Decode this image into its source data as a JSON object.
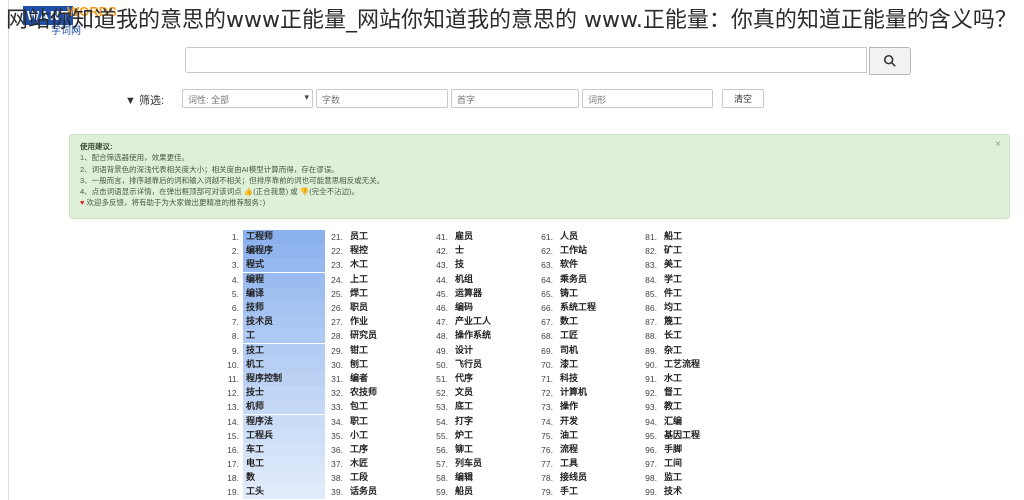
{
  "overlay_title": "网站你知道我的意思的www正能量_网站你知道我的意思的 www.正能量：你真的知道正能量的含义吗？",
  "logo": {
    "want": "WANT",
    "words": "WORDS",
    "sub": "字词网"
  },
  "search": {
    "placeholder": ""
  },
  "filter": {
    "label": "▼ 筛选:",
    "pos_select": "词性: 全部",
    "char_placeholder": "字数",
    "start_placeholder": "首字",
    "end_placeholder": "词形",
    "clear_label": "清空"
  },
  "tips": {
    "title": "使用建议:",
    "lines": [
      "1、配合筛选器使用，效果更佳。",
      "2、词语背景色的深浅代表相关度大小；相关度由AI模型计算而得，存在谬误。",
      "3、一般而言，排序越靠后的词和输入词越不相关；但排序靠前的词也可能意思相反或无关。",
      "4、点击词语显示详情，在弹出框顶部可对该词点 👍(正合我意) 或 👎(完全不沾边)。",
      "欢迎多反馈，将有助于为大家做出更精准的推荐服务：)"
    ]
  },
  "colors": {
    "accent": "#1f4fa8",
    "tips_bg": "#dff0d8",
    "highlight": "#8fb4ec"
  },
  "words": {
    "col1": [
      "工程师",
      "编程序",
      "程式",
      "编程",
      "编译",
      "技师",
      "技术员",
      "工",
      "技工",
      "机工",
      "程序控制",
      "技士",
      "机师",
      "程序法",
      "工程兵",
      "车工",
      "电工",
      "数",
      "工头"
    ],
    "col2": [
      "员工",
      "程控",
      "木工",
      "上工",
      "焊工",
      "职员",
      "作业",
      "研究员",
      "钳工",
      "刨工",
      "编者",
      "农技师",
      "包工",
      "职工",
      "小工",
      "工序",
      "木匠",
      "工段",
      "话务员"
    ],
    "col3": [
      "雇员",
      "士",
      "技",
      "机组",
      "运算器",
      "编码",
      "产业工人",
      "操作系统",
      "设计",
      "飞行员",
      "代序",
      "文员",
      "底工",
      "打字",
      "炉工",
      "铆工",
      "列车员",
      "编辑",
      "船员"
    ],
    "col4": [
      "人员",
      "工作站",
      "软件",
      "乘务员",
      "铸工",
      "系统工程",
      "数工",
      "工匠",
      "司机",
      "漆工",
      "科技",
      "计算机",
      "操作",
      "开发",
      "油工",
      "流程",
      "工具",
      "接线员",
      "手工"
    ],
    "col5": [
      "船工",
      "矿工",
      "美工",
      "学工",
      "件工",
      "均工",
      "篾工",
      "长工",
      "杂工",
      "工艺流程",
      "水工",
      "督工",
      "教工",
      "汇编",
      "基因工程",
      "手脚",
      "工间",
      "监工",
      "技术"
    ]
  }
}
